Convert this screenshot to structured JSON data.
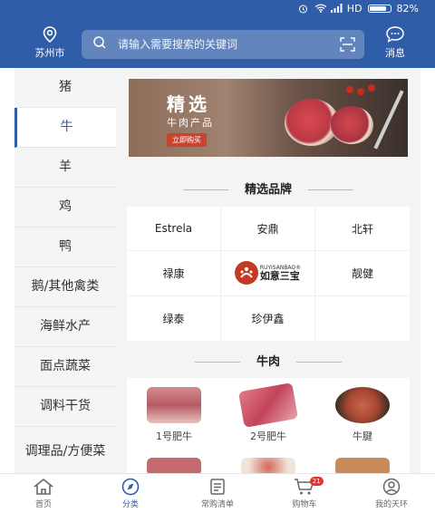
{
  "status": {
    "hd": "HD",
    "battery": "82%",
    "battery_level": 0.82
  },
  "header": {
    "location": "苏州市",
    "search_placeholder": "请输入需要搜索的关键词",
    "messages_label": "消息"
  },
  "sidebar": {
    "items": [
      {
        "label": "猪"
      },
      {
        "label": "牛"
      },
      {
        "label": "羊"
      },
      {
        "label": "鸡"
      },
      {
        "label": "鸭"
      },
      {
        "label": "鹅/其他禽类"
      },
      {
        "label": "海鲜水产"
      },
      {
        "label": "面点蔬菜"
      },
      {
        "label": "调料干货"
      },
      {
        "label": "调理品/方便菜"
      }
    ]
  },
  "banner": {
    "title": "精选",
    "subtitle": "牛肉产品",
    "button": "立即购买"
  },
  "brands_section": {
    "title": "精选品牌",
    "brands": [
      "Estrela",
      "安鼎",
      "北轩",
      "禄康",
      "",
      "靓健",
      "绿泰",
      "珍伊鑫",
      ""
    ],
    "logo_brand": {
      "en": "RUYISANBAO®",
      "cn": "如意三宝"
    }
  },
  "beef_section": {
    "title": "牛肉",
    "products": [
      {
        "name": "1号肥牛"
      },
      {
        "name": "2号肥牛"
      },
      {
        "name": "牛腱"
      }
    ]
  },
  "tabbar": {
    "tabs": [
      {
        "label": "首页"
      },
      {
        "label": "分类"
      },
      {
        "label": "常购清单"
      },
      {
        "label": "购物车"
      },
      {
        "label": "我的天环"
      }
    ],
    "cart_count": "21"
  },
  "colors": {
    "brand_blue": "#2f5da8",
    "badge_red": "#e23131"
  }
}
